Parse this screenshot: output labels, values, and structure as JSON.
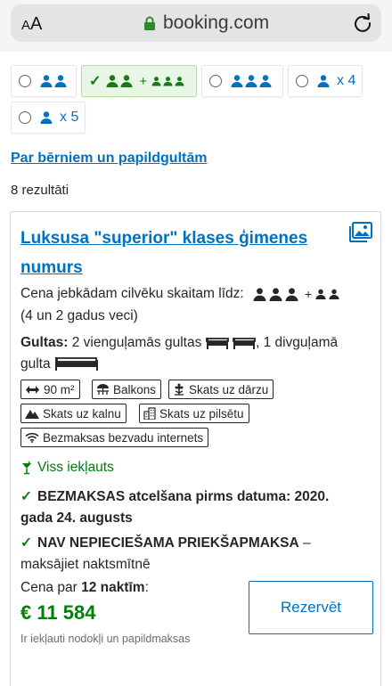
{
  "browser": {
    "aa_small": "A",
    "aa_large": "A",
    "domain": "booking.com"
  },
  "occupancy": {
    "opt3_suffix": "x 4",
    "opt5_suffix": "x 5",
    "plus": "+"
  },
  "children_link": "Par bērniem un papildgultām",
  "results_count": "8 rezultāti",
  "room": {
    "title": "Luksusa \"superior\" klases ģimenes numurs",
    "price_any_guests": "Cena jebkādam cilvēku skaitam līdz:",
    "kids_ages": "(4 un 2 gadus veci)",
    "beds_label": "Gultas:",
    "beds_text1": " 2 vienguļamās gultas ",
    "beds_text2": ", 1 divguļamā",
    "beds_text3": "gulta",
    "facilities": {
      "area": "90 m²",
      "balcony": "Balkons",
      "garden_view": "Skats uz dārzu",
      "mountain_view": "Skats uz kalnu",
      "city_view": "Skats uz pilsētu",
      "wifi": "Bezmaksas bezvadu internets"
    },
    "all_inclusive": "Viss iekļauts",
    "cancel_bold": "BEZMAKSAS atcelšana pirms datuma: 2020.",
    "cancel_bold2": "gada 24. augusts",
    "prepay_bold": "NAV NEPIECIEŠAMA PRIEKŠAPMAKSA",
    "prepay_rest": " –",
    "prepay_line2": "maksājiet naktsmītnē",
    "price_for": "Cena par ",
    "nights": "12 naktīm",
    "price_colon": ":",
    "price": "€ 11 584",
    "taxes_note": "Ir iekļauti nodokļi un papildmaksas",
    "reserve_button": "Rezervēt"
  },
  "colors": {
    "link_blue": "#0071c2",
    "green": "#008009",
    "selected_bg": "#e8f6e5"
  }
}
